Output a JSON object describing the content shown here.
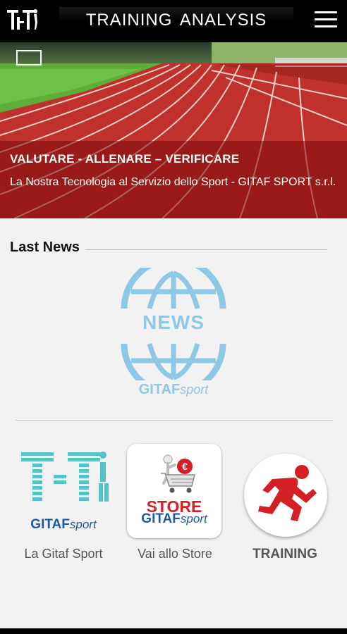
{
  "app": {
    "title": "TRAINING  ANALYSIS",
    "logo_icon": "tt-logo-icon",
    "menu_icon": "hamburger-menu-icon"
  },
  "hero": {
    "headline": "VALUTARE - ALLENARE – VERIFICARE",
    "subtitle": "La Nostra Tecnologia al Servizio dello Sport - GITAF SPORT s.r.l."
  },
  "news": {
    "section_title": "Last News",
    "badge_word": "NEWS",
    "brand_main": "GITAF",
    "brand_script": "sport"
  },
  "tiles": [
    {
      "label": "La Gitaf Sport",
      "brand_main": "GITAF",
      "brand_script": "sport",
      "icon": "gitaf-logo-icon"
    },
    {
      "label": "Vai allo Store",
      "store_word": "STORE",
      "brand_main": "GITAF",
      "brand_script": "sport",
      "icon": "store-cart-icon"
    },
    {
      "label": "TRAINING",
      "icon": "runner-icon"
    }
  ],
  "colors": {
    "topbar": "#000000",
    "track_red": "#c0302c",
    "news_blue": "#8fc8e6",
    "brand_blue": "#1c5aa6",
    "store_red": "#d31f26",
    "background": "#f2f2f2"
  }
}
